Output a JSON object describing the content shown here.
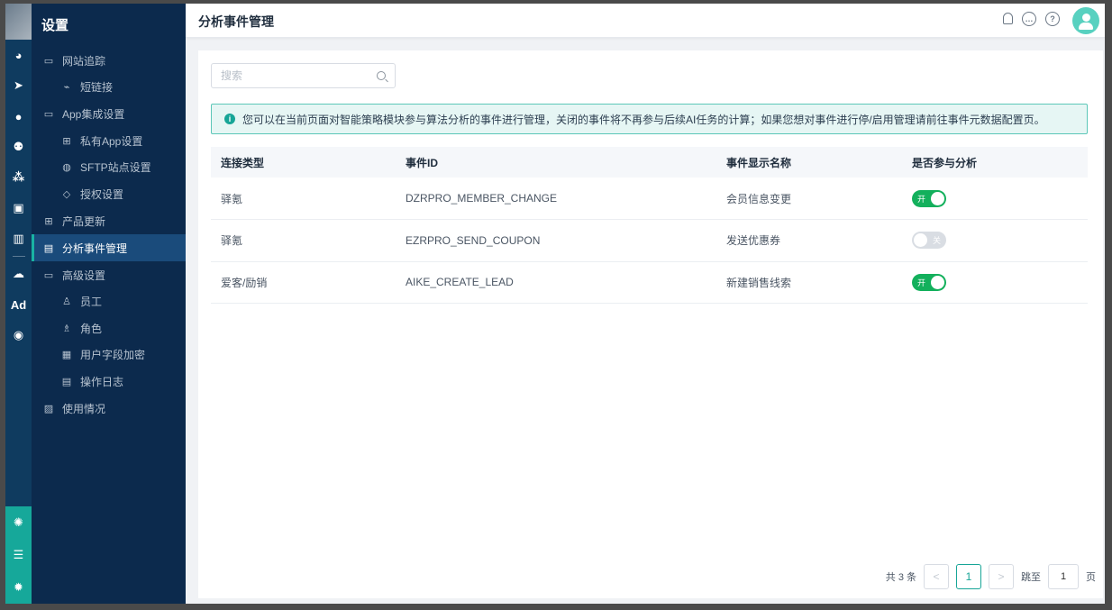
{
  "app": {
    "section_title": "设置",
    "page_title": "分析事件管理"
  },
  "sidebar": {
    "items": [
      {
        "label": "网站追踪",
        "icon": "folder-icon",
        "level": 1
      },
      {
        "label": "短链接",
        "icon": "link-icon",
        "level": 2
      },
      {
        "label": "App集成设置",
        "icon": "folder-icon",
        "level": 1
      },
      {
        "label": "私有App设置",
        "icon": "grid-icon",
        "level": 2
      },
      {
        "label": "SFTP站点设置",
        "icon": "globe-icon",
        "level": 2
      },
      {
        "label": "授权设置",
        "icon": "shield-icon",
        "level": 2
      },
      {
        "label": "产品更新",
        "icon": "apps-icon",
        "level": 1
      },
      {
        "label": "分析事件管理",
        "icon": "event-icon",
        "level": 1,
        "active": true
      },
      {
        "label": "高级设置",
        "icon": "folder-icon",
        "level": 1
      },
      {
        "label": "员工",
        "icon": "user-icon",
        "level": 2
      },
      {
        "label": "角色",
        "icon": "role-icon",
        "level": 2
      },
      {
        "label": "用户字段加密",
        "icon": "encrypt-icon",
        "level": 2
      },
      {
        "label": "操作日志",
        "icon": "log-icon",
        "level": 2
      },
      {
        "label": "使用情况",
        "icon": "usage-icon",
        "level": 1
      }
    ]
  },
  "search": {
    "placeholder": "搜索",
    "value": ""
  },
  "notice": {
    "text": "您可以在当前页面对智能策略模块参与算法分析的事件进行管理，关闭的事件将不再参与后续AI任务的计算；如果您想对事件进行停/启用管理请前往事件元数据配置页。"
  },
  "table": {
    "headers": [
      "连接类型",
      "事件ID",
      "事件显示名称",
      "是否参与分析"
    ],
    "rows": [
      {
        "type": "驿氪",
        "event_id": "DZRPRO_MEMBER_CHANGE",
        "name": "会员信息变更",
        "enabled": true,
        "toggle_label": "开"
      },
      {
        "type": "驿氪",
        "event_id": "EZRPRO_SEND_COUPON",
        "name": "发送优惠券",
        "enabled": false,
        "toggle_label": "关"
      },
      {
        "type": "爱客/励销",
        "event_id": "AIKE_CREATE_LEAD",
        "name": "新建销售线索",
        "enabled": true,
        "toggle_label": "开"
      }
    ]
  },
  "pagination": {
    "total_text": "共 3 条",
    "prev": "<",
    "current": "1",
    "next": ">",
    "jump_label": "跳至",
    "jump_value": "1",
    "page_suffix": "页"
  },
  "rail": {
    "ad_label": "Ad"
  },
  "colors": {
    "accent": "#17a597",
    "toggle_on": "#13b05c",
    "sidebar_bg": "#0c2a4d",
    "rail_bg": "#0f3b5f"
  }
}
